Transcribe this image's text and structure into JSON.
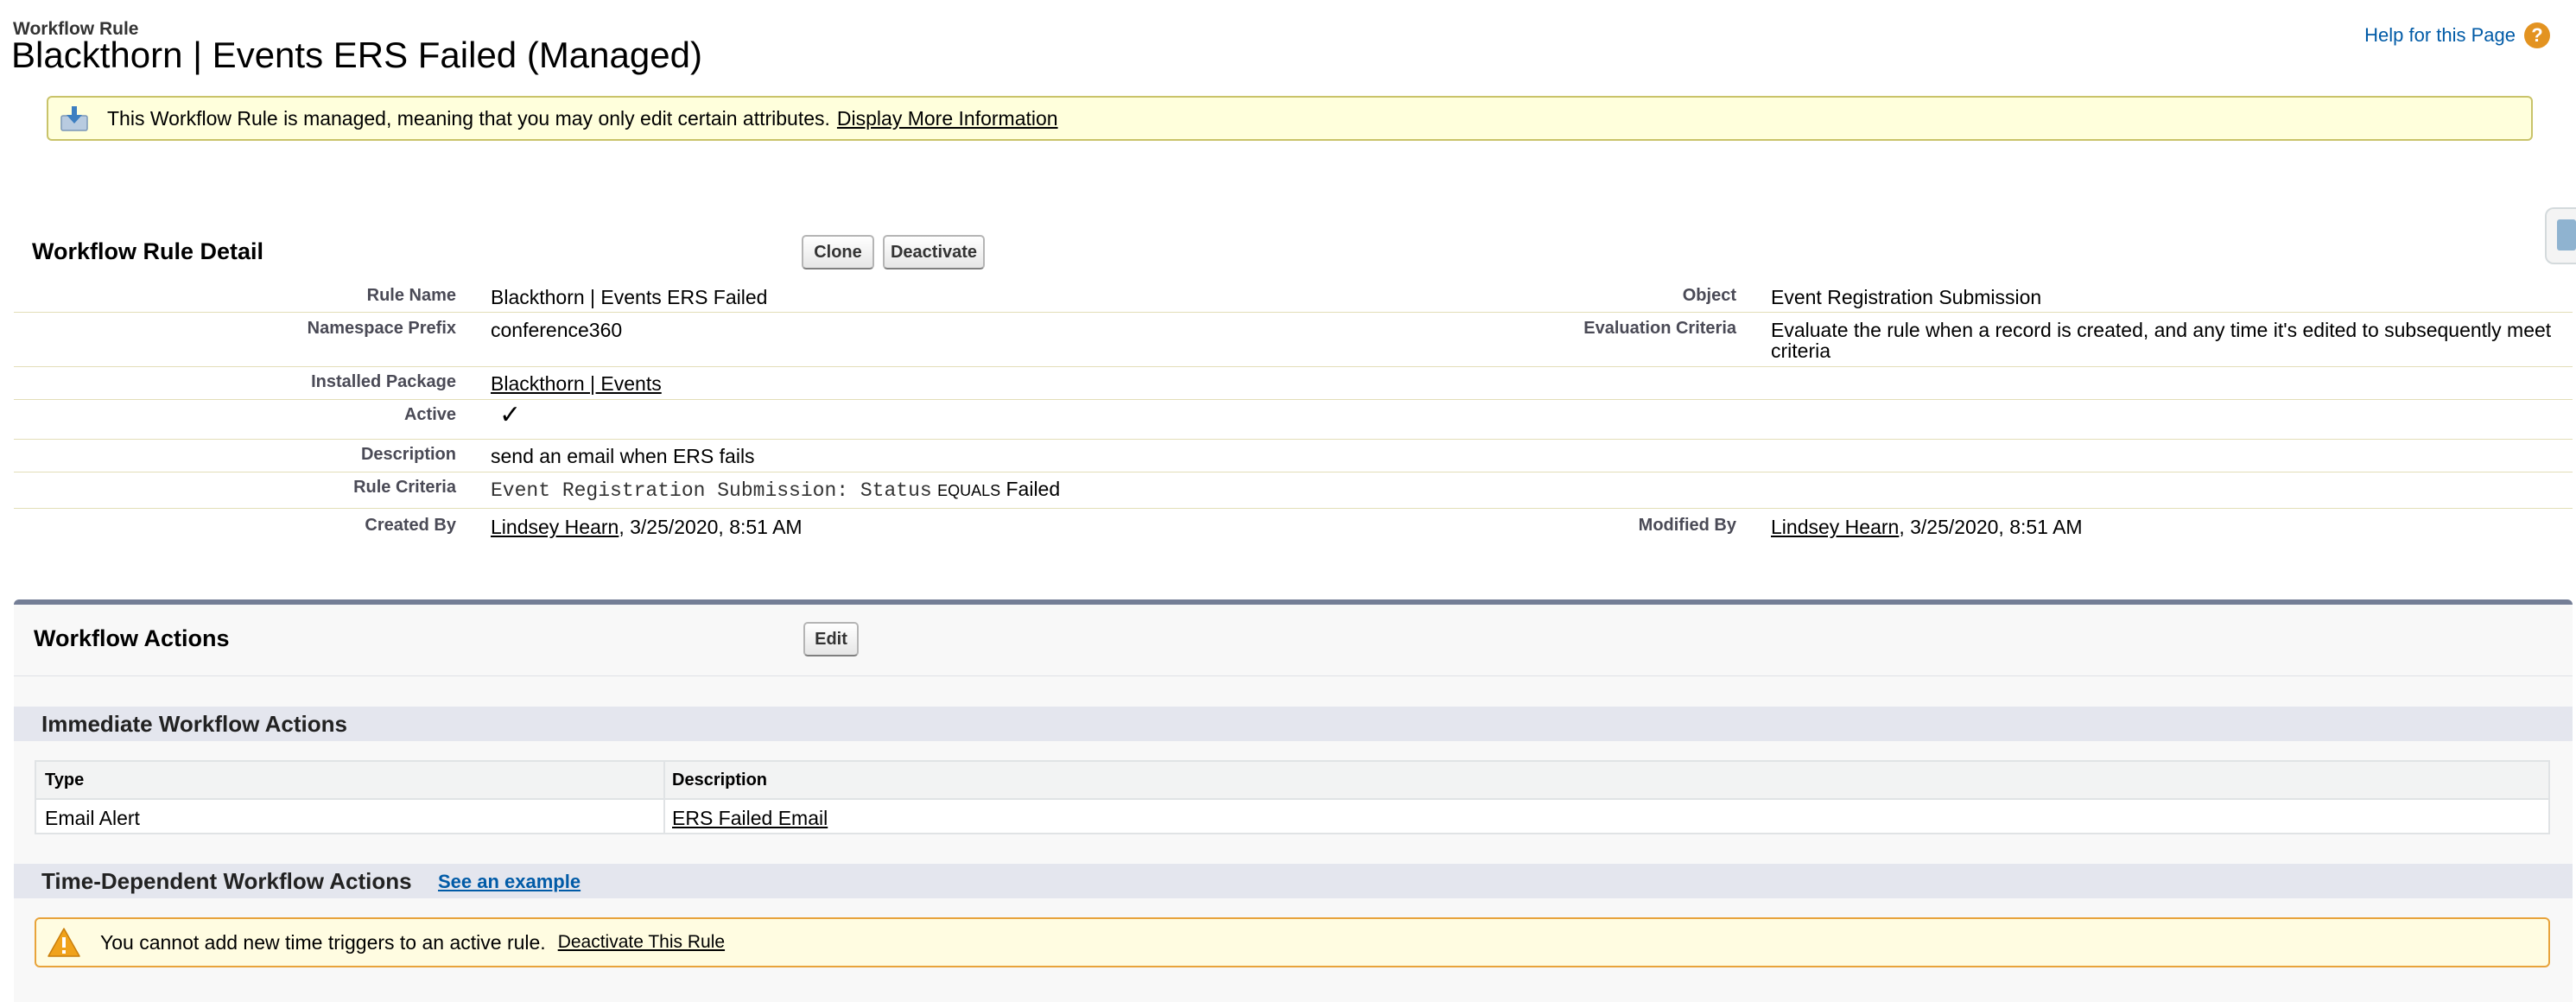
{
  "header": {
    "page_type": "Workflow Rule",
    "title": "Blackthorn | Events ERS Failed (Managed)",
    "help_link": "Help for this Page",
    "help_icon": "?"
  },
  "managed_banner": {
    "icon": "download-icon",
    "message": "This Workflow Rule is managed, meaning that you may only edit certain attributes.",
    "link": "Display More Information"
  },
  "detail": {
    "title": "Workflow Rule Detail",
    "buttons": {
      "clone": "Clone",
      "deactivate": "Deactivate"
    },
    "labels": {
      "rule_name": "Rule Name",
      "namespace_prefix": "Namespace Prefix",
      "installed_package": "Installed Package",
      "active": "Active",
      "description": "Description",
      "rule_criteria": "Rule Criteria",
      "created_by": "Created By",
      "object": "Object",
      "evaluation_criteria": "Evaluation Criteria",
      "modified_by": "Modified By"
    },
    "values": {
      "rule_name": "Blackthorn | Events ERS Failed",
      "namespace_prefix": "conference360",
      "installed_package": "Blackthorn | Events",
      "active": "✓",
      "description": "send an email when ERS fails",
      "rule_criteria_field": "Event Registration Submission: Status",
      "rule_criteria_operator": "EQUALS",
      "rule_criteria_value": "Failed",
      "created_by_user": "Lindsey Hearn",
      "created_by_date": ", 3/25/2020, 8:51 AM",
      "object": "Event Registration Submission",
      "evaluation_criteria_line1": "Evaluate the rule when a record is created, and any time it's edited to subsequently meet",
      "evaluation_criteria_line2": "criteria",
      "modified_by_user": "Lindsey Hearn",
      "modified_by_date": ", 3/25/2020, 8:51 AM"
    }
  },
  "workflow_actions": {
    "title": "Workflow Actions",
    "edit_button": "Edit",
    "immediate": {
      "title": "Immediate Workflow Actions",
      "columns": [
        "Type",
        "Description"
      ],
      "rows": [
        {
          "type": "Email Alert",
          "description": "ERS Failed Email"
        }
      ]
    },
    "time_dependent": {
      "title": "Time-Dependent Workflow Actions",
      "example_link": "See an example",
      "warning_icon": "warning-icon",
      "warning": "You cannot add new time triggers to an active rule.",
      "warning_link": "Deactivate This Rule"
    }
  },
  "colors": {
    "link_blue": "#015ba7",
    "help_orange": "#e39321",
    "section_border": "#747e96",
    "warning_border": "#e8a33b"
  }
}
